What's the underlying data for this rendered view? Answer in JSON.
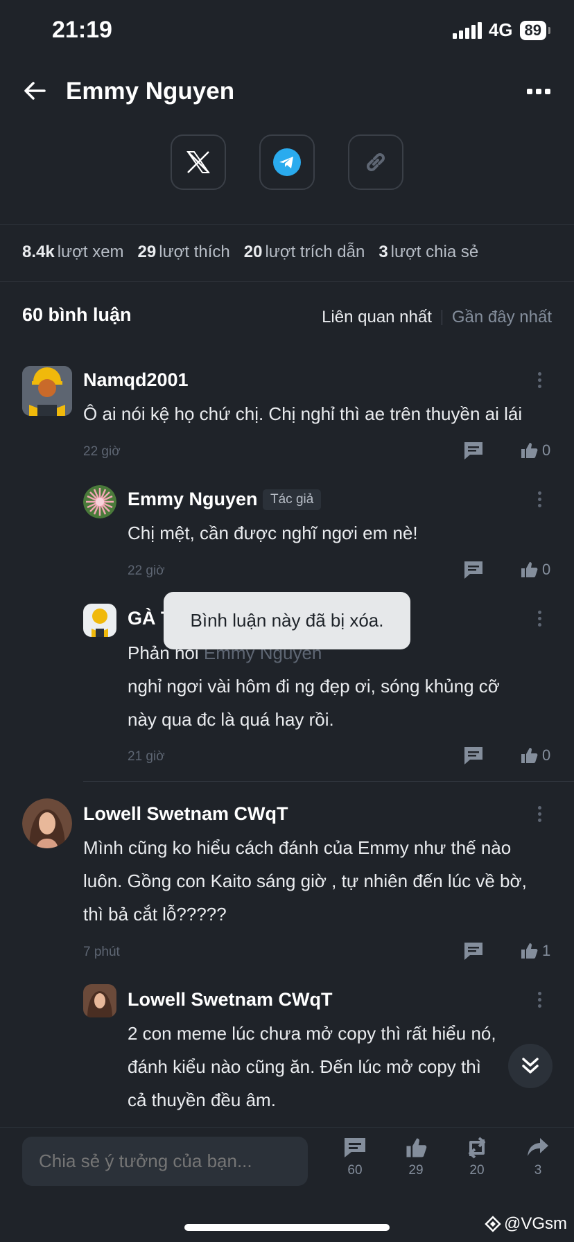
{
  "status": {
    "time": "21:19",
    "network": "4G",
    "battery": "89"
  },
  "header": {
    "title": "Emmy Nguyen"
  },
  "stats": [
    {
      "value": "8.4k",
      "label": "lượt xem"
    },
    {
      "value": "29",
      "label": "lượt thích"
    },
    {
      "value": "20",
      "label": "lượt trích dẫn"
    },
    {
      "value": "3",
      "label": "lượt chia sẻ"
    }
  ],
  "comments_header": {
    "count_label": "60 bình luận",
    "sort_relevant": "Liên quan nhất",
    "sort_recent": "Gần đây nhất"
  },
  "comments": [
    {
      "name": "Namqd2001",
      "text": "Ô ai nói kệ họ chứ chị. Chị nghỉ thì ae trên thuyền ai lái",
      "time": "22 giờ",
      "likes": "0"
    },
    {
      "name": "Emmy Nguyen",
      "tag": "Tác giả",
      "text": "Chị mệt, cần được nghĩ ngơi em nè!",
      "time": "22 giờ",
      "likes": "0"
    },
    {
      "name": "GÀ TIỀ",
      "reply_prefix": "Phản hồi",
      "reply_to": "Emmy Nguyen",
      "text_lines": [
        "nghỉ ngơi vài hôm đi ng đẹp ơi, sóng khủng cỡ",
        "này qua đc là quá hay rồi."
      ],
      "time": "21 giờ",
      "likes": "0"
    },
    {
      "name": "Lowell Swetnam CWqT",
      "text_lines": [
        "Mình cũng ko hiểu cách đánh của Emmy như thế nào",
        "luôn. Gồng con Kaito sáng giờ , tự nhiên đến lúc về bờ,",
        "thì bả cắt lỗ?????"
      ],
      "time": "7 phút",
      "likes": "1"
    },
    {
      "name": "Lowell Swetnam CWqT",
      "text_lines": [
        "2 con meme lúc chưa mở copy thì rất hiểu nó,",
        "đánh kiểu nào cũng ăn. Đến lúc mở copy thì",
        "cả thuyền đều âm."
      ]
    }
  ],
  "toast": "Bình luận này đã bị xóa.",
  "bottom": {
    "placeholder": "Chia sẻ ý tưởng của bạn...",
    "comments": "60",
    "likes": "29",
    "quotes": "20",
    "shares": "3"
  },
  "watermark": "@VGsm",
  "colors": {
    "background": "#1f2329",
    "accent_telegram": "#2aabee",
    "text_muted": "#848e9c"
  }
}
